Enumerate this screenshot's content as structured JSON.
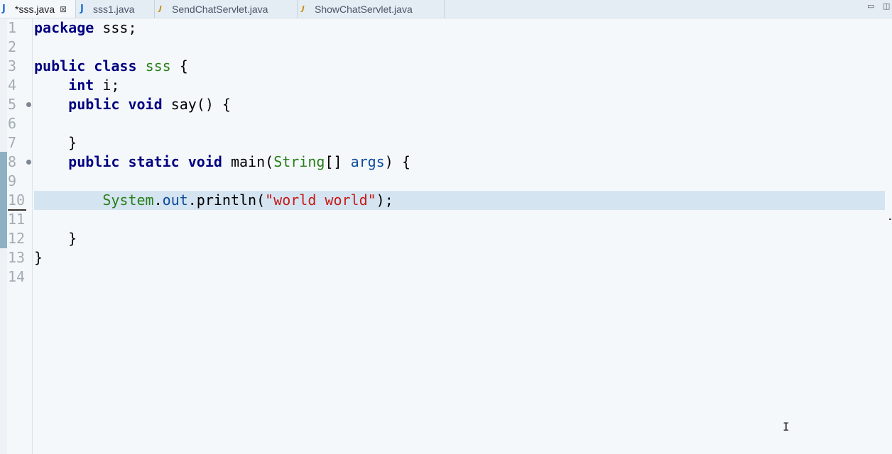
{
  "tabs": [
    {
      "label": "*sss.java",
      "icon": "java-file-icon",
      "active": true,
      "close": "⊠"
    },
    {
      "label": "sss1.java",
      "icon": "java-file-icon",
      "active": false
    },
    {
      "label": "SendChatServlet.java",
      "icon": "java-servlet-icon",
      "active": false
    },
    {
      "label": "ShowChatServlet.java",
      "icon": "java-servlet-icon",
      "active": false
    }
  ],
  "window_controls": {
    "minimize": "▭",
    "maximize": "◫"
  },
  "editor": {
    "current_line": 10,
    "lines": [
      {
        "n": "1",
        "tokens": [
          [
            "kw",
            "package"
          ],
          [
            "pl",
            " sss;"
          ]
        ]
      },
      {
        "n": "2",
        "tokens": []
      },
      {
        "n": "3",
        "tokens": [
          [
            "kw",
            "public"
          ],
          [
            "pl",
            " "
          ],
          [
            "kw",
            "class"
          ],
          [
            "pl",
            " "
          ],
          [
            "typ",
            "sss"
          ],
          [
            "pl",
            " {"
          ]
        ]
      },
      {
        "n": "4",
        "tokens": [
          [
            "pl",
            "    "
          ],
          [
            "kw",
            "int"
          ],
          [
            "pl",
            " i;"
          ]
        ]
      },
      {
        "n": "5",
        "tokens": [
          [
            "pl",
            "    "
          ],
          [
            "kw",
            "public"
          ],
          [
            "pl",
            " "
          ],
          [
            "kw",
            "void"
          ],
          [
            "pl",
            " say() {"
          ]
        ],
        "fold": true
      },
      {
        "n": "6",
        "tokens": []
      },
      {
        "n": "7",
        "tokens": [
          [
            "pl",
            "    }"
          ]
        ]
      },
      {
        "n": "8",
        "tokens": [
          [
            "pl",
            "    "
          ],
          [
            "kw",
            "public"
          ],
          [
            "pl",
            " "
          ],
          [
            "kw",
            "static"
          ],
          [
            "pl",
            " "
          ],
          [
            "kw",
            "void"
          ],
          [
            "pl",
            " main("
          ],
          [
            "typ",
            "String"
          ],
          [
            "pl",
            "[] "
          ],
          [
            "fld",
            "args"
          ],
          [
            "pl",
            ") {"
          ]
        ],
        "fold": true
      },
      {
        "n": "9",
        "tokens": []
      },
      {
        "n": "10",
        "tokens": [
          [
            "pl",
            "        "
          ],
          [
            "typ",
            "System"
          ],
          [
            "pl",
            "."
          ],
          [
            "fld",
            "out"
          ],
          [
            "pl",
            ".println("
          ],
          [
            "str",
            "\"world world\""
          ],
          [
            "pl",
            ");"
          ]
        ]
      },
      {
        "n": "11",
        "tokens": []
      },
      {
        "n": "12",
        "tokens": [
          [
            "pl",
            "    }"
          ]
        ]
      },
      {
        "n": "13",
        "tokens": [
          [
            "pl",
            "}"
          ]
        ]
      },
      {
        "n": "14",
        "tokens": []
      }
    ]
  },
  "colors": {
    "keyword": "#000080",
    "type": "#267f17",
    "field": "#0b4b9c",
    "string": "#c41a16",
    "current_line_bg": "#d5e4f1"
  },
  "mouse_cursor": "I"
}
